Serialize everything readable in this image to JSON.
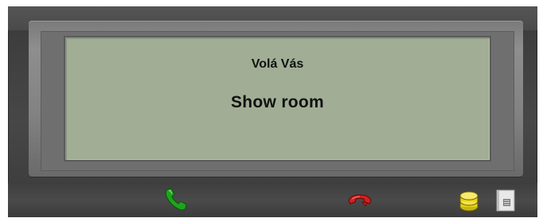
{
  "screen": {
    "caller_label": "Volá Vás",
    "caller_name": "Show room"
  },
  "buttons": {
    "answer_icon": "phone-answer-icon",
    "hangup_icon": "phone-hangup-icon",
    "contacts_icon": "database-icon",
    "log_icon": "document-icon"
  },
  "colors": {
    "screen_background": "#a1ae95",
    "answer": "#1fa31f",
    "hangup": "#d42020",
    "database": "#e6d21a"
  }
}
